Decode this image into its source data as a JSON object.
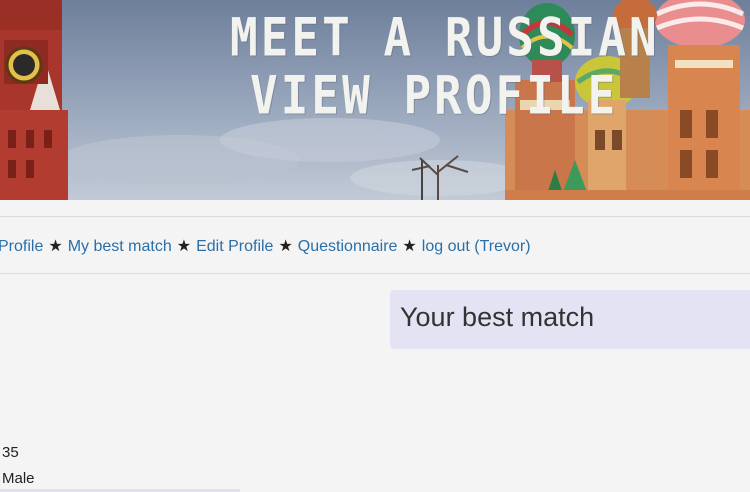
{
  "banner": {
    "line1": "MEET A RUSSIAN",
    "line2": "VIEW PROFILE",
    "sky_color": "#8a9bb4",
    "tower_color": "#a8362c"
  },
  "nav": {
    "items": [
      {
        "label": "Profile"
      },
      {
        "label": "My best match"
      },
      {
        "label": "Edit Profile"
      },
      {
        "label": "Questionnaire"
      },
      {
        "label": "log out (Trevor)"
      }
    ],
    "separator": "★",
    "link_color": "#2a6fa8"
  },
  "match": {
    "heading": "Your best match",
    "background": "#e3e3f3"
  },
  "profile": {
    "age": "35",
    "gender": "Male"
  }
}
